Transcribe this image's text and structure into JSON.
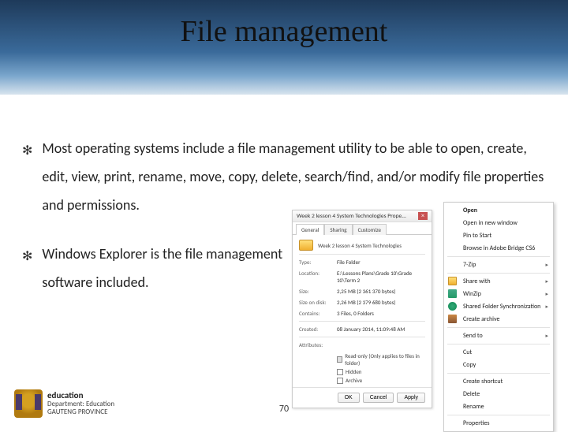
{
  "title": "File management",
  "bullets": [
    "Most operating systems include a file management utility to be able to open, create, edit, view, print, rename, move, copy, delete, search/find, and/or modify file properties and permissions.",
    "Windows Explorer is the file management software included."
  ],
  "page_number": "70",
  "logo": {
    "line1": "education",
    "line2": "Department: Education",
    "line3": "GAUTENG PROVINCE"
  },
  "properties_dialog": {
    "title": "Week  2 lesson 4 System Technologies Prope...",
    "tabs": [
      "General",
      "Sharing",
      "Customize"
    ],
    "folder_name": "Week  2 lesson 4 System Technologies",
    "rows": {
      "type_label": "Type:",
      "type_value": "File Folder",
      "location_label": "Location:",
      "location_value": "E:\\Lessons Plans\\Grade 10\\Grade 10\\Term 2",
      "size_label": "Size:",
      "size_value": "2,25 MB (2 361 370 bytes)",
      "size_disk_label": "Size on disk:",
      "size_disk_value": "2,26 MB (2 379 680 bytes)",
      "contains_label": "Contains:",
      "contains_value": "3 Files, 0 Folders",
      "created_label": "Created:",
      "created_value": "08 January 2014, 11:09:48 AM",
      "attributes_label": "Attributes:",
      "readonly": "Read-only (Only applies to files in folder)",
      "hidden": "Hidden",
      "archive": "Archive"
    },
    "buttons": {
      "ok": "OK",
      "cancel": "Cancel",
      "apply": "Apply"
    }
  },
  "context_menu": {
    "items": [
      "Open",
      "Open in new window",
      "Pin to Start",
      "Browse in Adobe Bridge CS6"
    ],
    "zip_header": "7-Zip",
    "share": "Share with",
    "winzip": "WinZip",
    "sync": "Shared Folder Synchronization",
    "archive": "Create archive",
    "sendto": "Send to",
    "cut": "Cut",
    "copy": "Copy",
    "shortcut": "Create shortcut",
    "delete": "Delete",
    "rename": "Rename",
    "properties": "Properties"
  }
}
